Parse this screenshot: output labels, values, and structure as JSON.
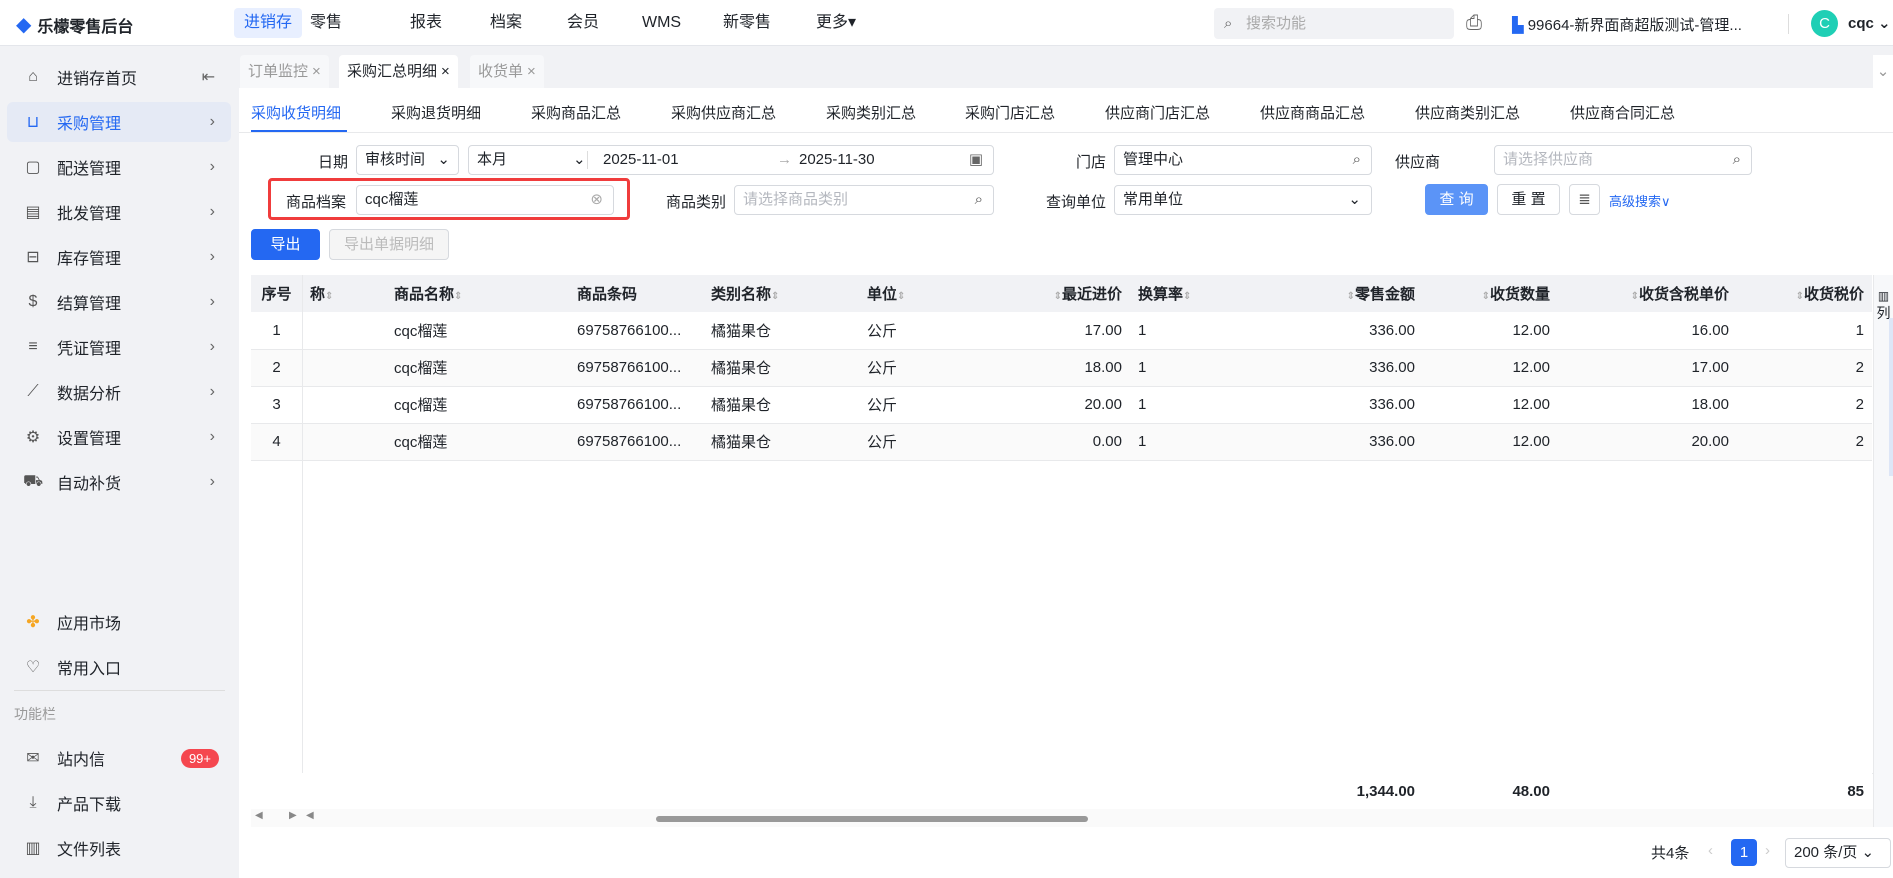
{
  "app": {
    "title": "乐檬零售后台",
    "nav": [
      "进销存",
      "零售",
      "报表",
      "档案",
      "会员",
      "WMS",
      "新零售",
      "更多▾"
    ],
    "search_placeholder": "搜索功能",
    "store": "99664-新界面商超版测试-管理...",
    "user": "cqc",
    "avatar": "C"
  },
  "sidebar": {
    "items": [
      {
        "label": "进销存首页",
        "icon": "home-icon"
      },
      {
        "label": "采购管理",
        "icon": "cart-icon"
      },
      {
        "label": "配送管理",
        "icon": "box-icon"
      },
      {
        "label": "批发管理",
        "icon": "drawer-icon"
      },
      {
        "label": "库存管理",
        "icon": "stock-icon"
      },
      {
        "label": "结算管理",
        "icon": "dollar-icon"
      },
      {
        "label": "凭证管理",
        "icon": "doc-icon"
      },
      {
        "label": "数据分析",
        "icon": "chart-icon"
      },
      {
        "label": "设置管理",
        "icon": "gear-icon"
      },
      {
        "label": "自动补货",
        "icon": "truck-icon"
      }
    ],
    "bottom": [
      {
        "label": "应用市场"
      },
      {
        "label": "常用入口"
      }
    ],
    "section": "功能栏",
    "tools": [
      {
        "label": "站内信",
        "badge": "99+"
      },
      {
        "label": "产品下载"
      },
      {
        "label": "文件列表"
      }
    ]
  },
  "tabs": [
    "订单监控",
    "采购汇总明细",
    "收货单"
  ],
  "subtabs": [
    "采购收货明细",
    "采购退货明细",
    "采购商品汇总",
    "采购供应商汇总",
    "采购类别汇总",
    "采购门店汇总",
    "供应商门店汇总",
    "供应商商品汇总",
    "供应商类别汇总",
    "供应商合同汇总"
  ],
  "filters": {
    "date_label": "日期",
    "date_type": "审核时间",
    "period": "本月",
    "start": "2025-11-01",
    "end": "2025-11-30",
    "store_label": "门店",
    "store": "管理中心",
    "supplier_label": "供应商",
    "supplier_ph": "请选择供应商",
    "product_label": "商品档案",
    "product": "cqc榴莲",
    "category_label": "商品类别",
    "category_ph": "请选择商品类别",
    "unit_label": "查询单位",
    "unit": "常用单位",
    "query": "查 询",
    "reset": "重 置",
    "advanced": "高级搜索∨"
  },
  "actions": {
    "export": "导出",
    "export_detail": "导出单据明细"
  },
  "table": {
    "columns": [
      "序号",
      "称",
      "商品名称",
      "商品条码",
      "类别名称",
      "单位",
      "最近进价",
      "换算率",
      "零售金额",
      "收货数量",
      "收货含税单价",
      "收货税价"
    ],
    "rows": [
      [
        "1",
        "",
        "cqc榴莲",
        "69758766100...",
        "橘猫果仓",
        "公斤",
        "17.00",
        "1",
        "336.00",
        "12.00",
        "16.00",
        "1"
      ],
      [
        "2",
        "",
        "cqc榴莲",
        "69758766100...",
        "橘猫果仓",
        "公斤",
        "18.00",
        "1",
        "336.00",
        "12.00",
        "17.00",
        "2"
      ],
      [
        "3",
        "",
        "cqc榴莲",
        "69758766100...",
        "橘猫果仓",
        "公斤",
        "20.00",
        "1",
        "336.00",
        "12.00",
        "18.00",
        "2"
      ],
      [
        "4",
        "",
        "cqc榴莲",
        "69758766100...",
        "橘猫果仓",
        "公斤",
        "0.00",
        "1",
        "336.00",
        "12.00",
        "20.00",
        "2"
      ]
    ],
    "totals": [
      "",
      "",
      "",
      "",
      "",
      "",
      "",
      "",
      "1,344.00",
      "48.00",
      "",
      "85"
    ],
    "col_toggle": "列"
  },
  "pagination": {
    "total": "共4条",
    "page": "1",
    "size": "200 条/页"
  }
}
